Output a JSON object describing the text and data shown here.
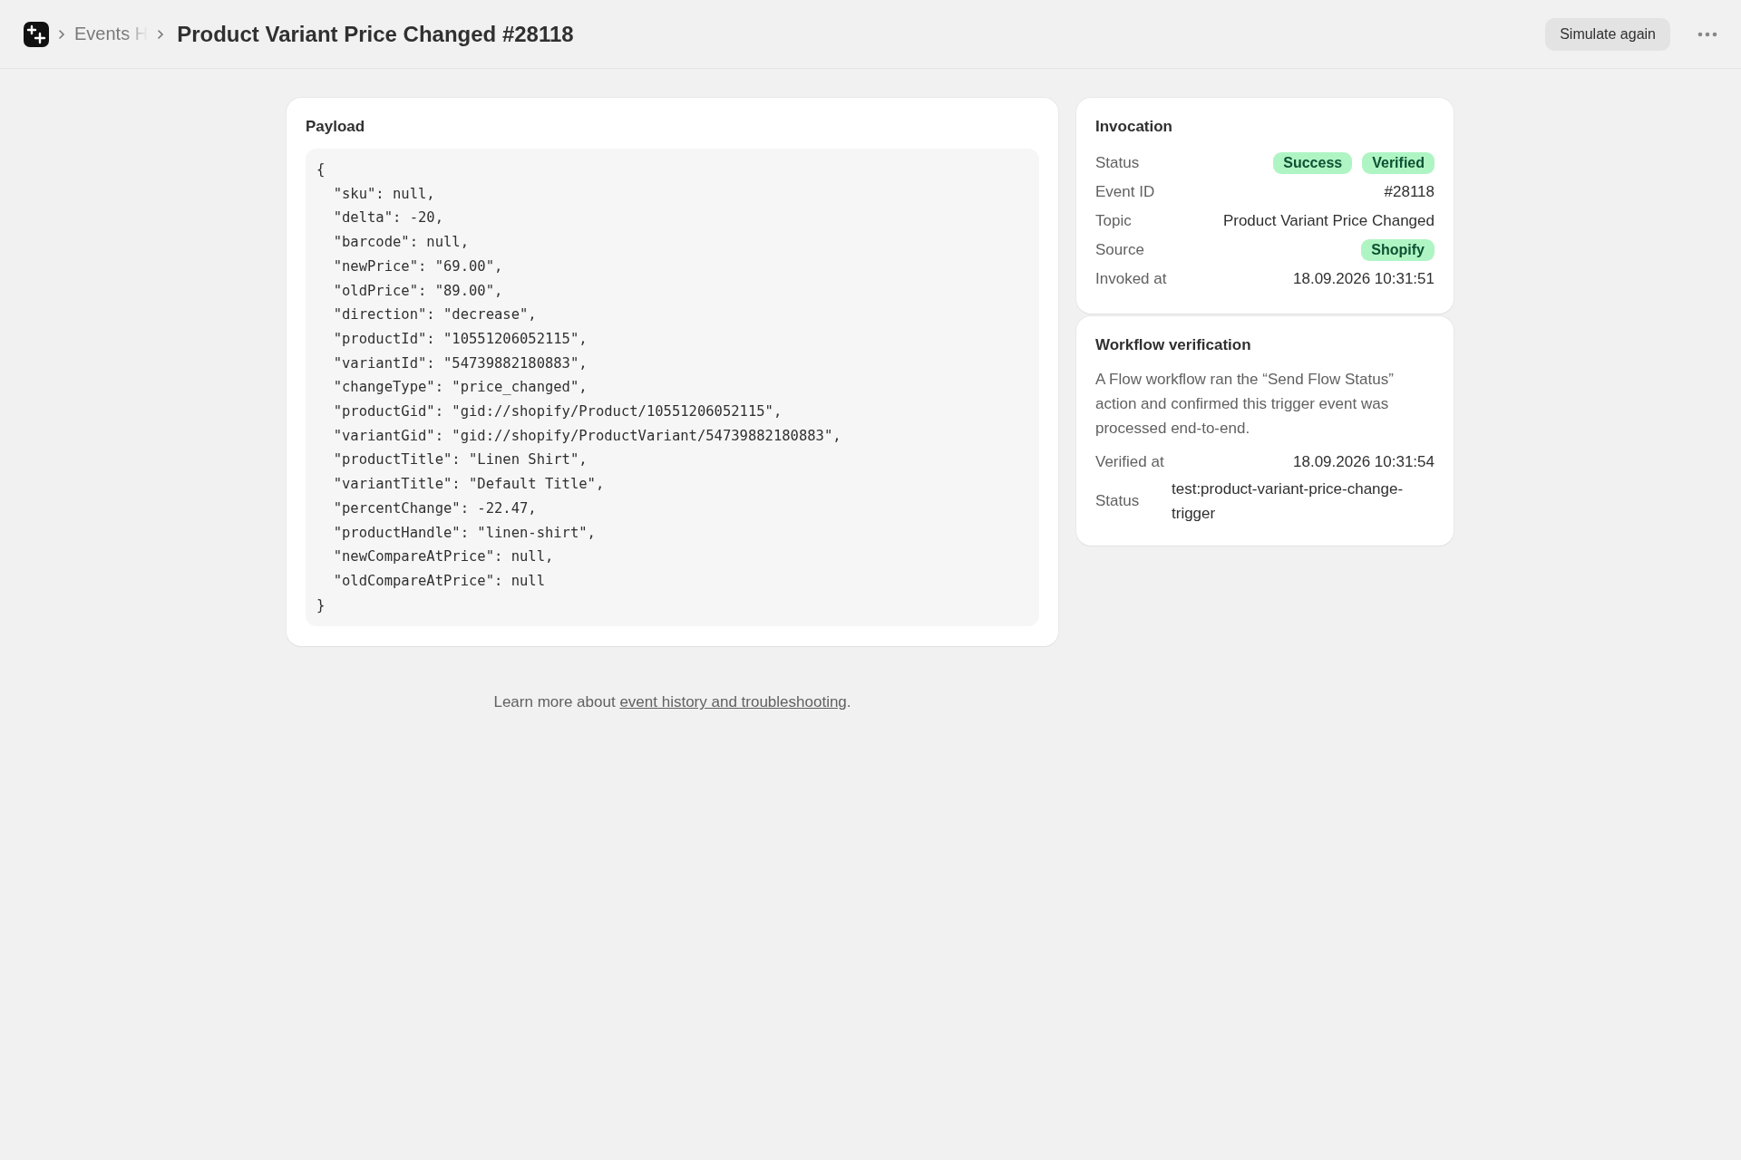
{
  "header": {
    "breadcrumb": [
      {
        "label": "Events H",
        "faded": true
      }
    ],
    "title": "Product Variant Price Changed #28118",
    "actions": [
      {
        "label": "Simulate again"
      }
    ]
  },
  "payload": {
    "title": "Payload",
    "lines": [
      "{",
      "  \"sku\": null,",
      "  \"delta\": -20,",
      "  \"barcode\": null,",
      "  \"newPrice\": \"69.00\",",
      "  \"oldPrice\": \"89.00\",",
      "  \"direction\": \"decrease\",",
      "  \"productId\": \"10551206052115\",",
      "  \"variantId\": \"54739882180883\",",
      "  \"changeType\": \"price_changed\",",
      "  \"productGid\": \"gid://shopify/Product/10551206052115\",",
      "  \"variantGid\": \"gid://shopify/ProductVariant/54739882180883\",",
      "  \"productTitle\": \"Linen Shirt\",",
      "  \"variantTitle\": \"Default Title\",",
      "  \"percentChange\": -22.47,",
      "  \"productHandle\": \"linen-shirt\",",
      "  \"newCompareAtPrice\": null,",
      "  \"oldCompareAtPrice\": null",
      "}"
    ]
  },
  "invocation": {
    "title": "Invocation",
    "rows": [
      {
        "label": "Status",
        "kind": "badges",
        "badges": [
          "Success",
          "Verified"
        ]
      },
      {
        "label": "Event ID",
        "kind": "text",
        "value": "#28118"
      },
      {
        "label": "Topic",
        "kind": "text",
        "value": "Product Variant Price Changed"
      },
      {
        "label": "Source",
        "kind": "badges",
        "badges": [
          "Shopify"
        ]
      },
      {
        "label": "Invoked at",
        "kind": "text",
        "value": "18.09.2026 10:31:51"
      }
    ]
  },
  "verification": {
    "title": "Workflow verification",
    "description": "A Flow workflow ran the “Send Flow Status” action and confirmed this trigger event was processed end-to-end.",
    "rows": [
      {
        "label": "Verified at",
        "kind": "text",
        "value": "18.09.2026 10:31:54"
      },
      {
        "label": "Status",
        "kind": "wrap",
        "value": "test:product-variant-price-change-trigger"
      }
    ]
  },
  "footer": {
    "text": "Learn more about",
    "link": "event history and troubleshooting",
    "end": "."
  }
}
